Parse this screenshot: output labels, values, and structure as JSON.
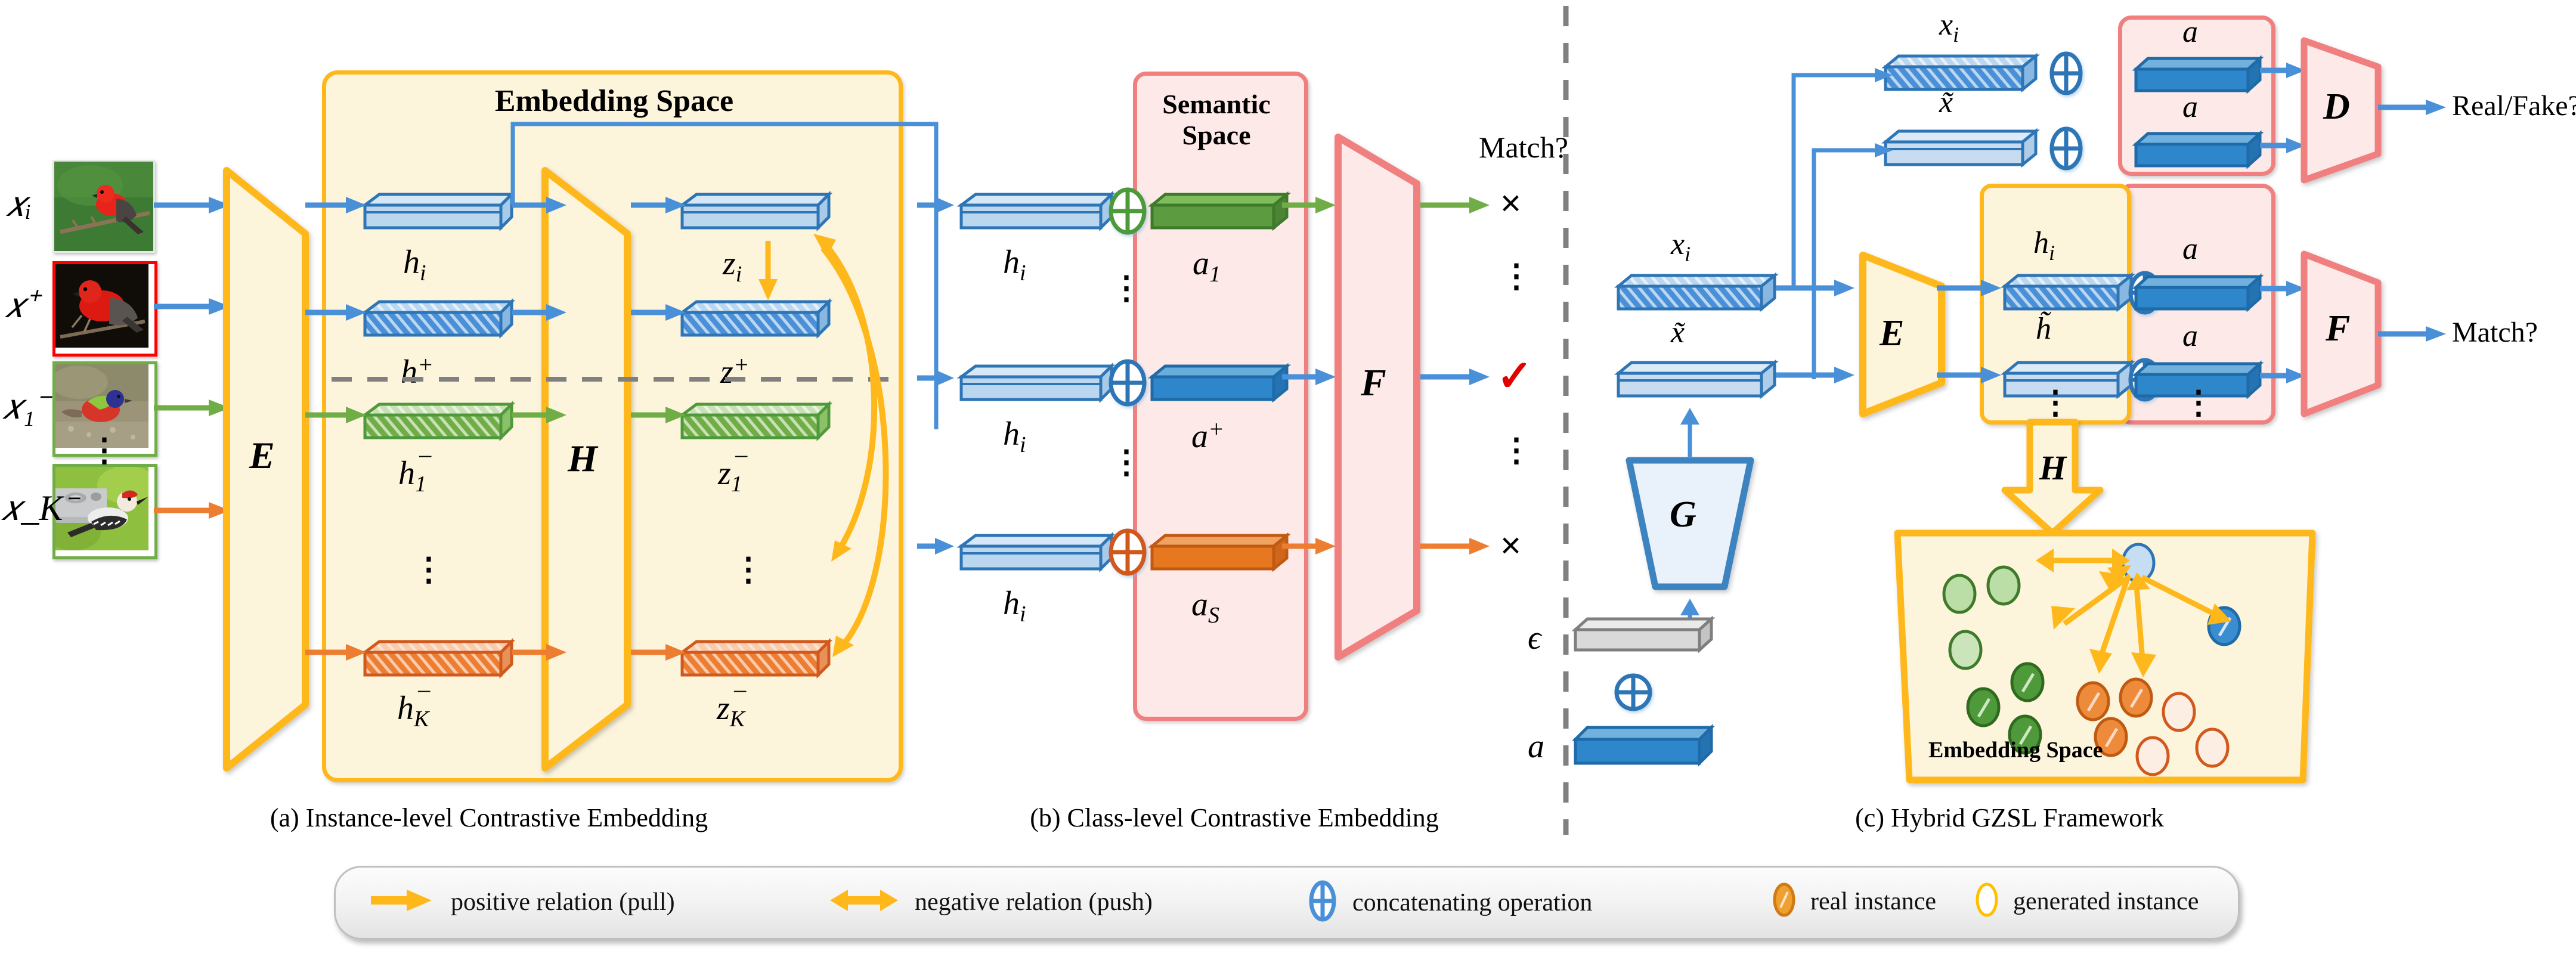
{
  "figure": {
    "panels": [
      {
        "id": "a",
        "caption": "(a) Instance-level Contrastive Embedding"
      },
      {
        "id": "b",
        "caption": "(b) Class-level Contrastive Embedding"
      },
      {
        "id": "c",
        "caption": "(c) Hybrid GZSL Framework"
      }
    ]
  },
  "panel_a": {
    "embedding_space_title": "Embedding Space",
    "encoder_label": "E",
    "projector_label": "H",
    "input_labels": [
      "x_i",
      "x^+",
      "x_1^-",
      "x_K^-"
    ],
    "input_labels_unicode": [
      "𝑥ᵢ",
      "𝑥⁺",
      "𝑥₁⁻",
      "𝑥_K⁻"
    ],
    "h_labels": [
      "h_i",
      "h^+",
      "h_1^-",
      "h_K^-"
    ],
    "z_labels": [
      "z_i",
      "z^+",
      "z_1^-",
      "z_K^-"
    ],
    "vertical_dots": "⋮",
    "images": [
      {
        "name": "vermilion-flycatcher-green",
        "border": "none"
      },
      {
        "name": "vermilion-flycatcher-dark",
        "border": "#FF0000"
      },
      {
        "name": "painted-bunting",
        "border": "#70AD47"
      },
      {
        "name": "red-bellied-woodpecker",
        "border": "#70AD47"
      }
    ]
  },
  "panel_b": {
    "semantic_space_title_line1": "Semantic",
    "semantic_space_title_line2": "Space",
    "relation_net_label": "F",
    "h_labels": [
      "h_i",
      "h_i",
      "h_i"
    ],
    "attribute_labels": [
      "a_1",
      "a^+",
      "a_S"
    ],
    "match_header": "Match?",
    "results": [
      "×",
      "✓",
      "×"
    ],
    "concat_symbol": "⊕",
    "vertical_dots": "⋮"
  },
  "panel_c": {
    "top_row_labels": [
      "x_i",
      "x̃"
    ],
    "attribute_label": "a",
    "discriminator_label": "D",
    "discriminator_output": "Real/Fake?",
    "relation_label": "F",
    "relation_output": "Match?",
    "encoder_label": "E",
    "generator_label": "G",
    "projector_label": "H",
    "hidden_labels": [
      "h_i",
      "h̃"
    ],
    "noise_label": "ϵ",
    "cond_attr_label": "a",
    "embedding_space_title": "Embedding Space",
    "concat_symbol": "⊕",
    "vertical_dots": "⋮"
  },
  "legend": {
    "items": [
      {
        "icon": "single-arrow-right-icon",
        "label": "positive relation (pull)",
        "color": "#FFB81C"
      },
      {
        "icon": "double-arrow-icon",
        "label": "negative relation (push)",
        "color": "#FFB81C"
      },
      {
        "icon": "concat-circle-icon",
        "label": "concatenating operation",
        "color": "#4A90D9"
      },
      {
        "icon": "filled-ellipse-icon",
        "label": "real instance",
        "color": "#ED9C28"
      },
      {
        "icon": "hollow-ellipse-icon",
        "label": "generated instance",
        "color": "#FFC000"
      }
    ]
  },
  "colors": {
    "orange_accent": "#FFB81C",
    "blue_accent": "#4A90D9",
    "green_accent": "#70AD47",
    "red_accent": "#ED7D31",
    "pink_panel_border": "#F08080",
    "pink_panel_fill": "#FDEAE8",
    "yellow_panel_fill": "#FDF4DC"
  }
}
